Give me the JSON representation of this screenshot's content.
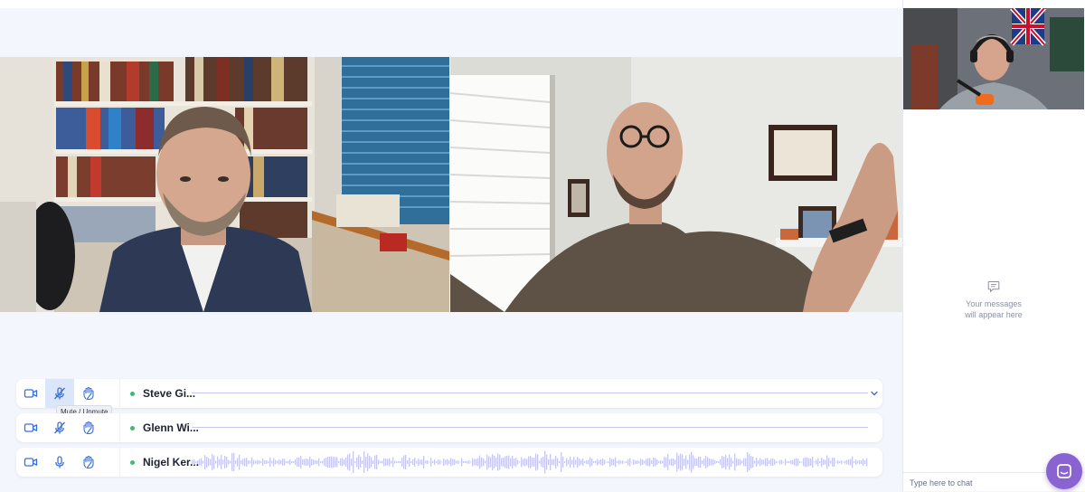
{
  "participants": [
    {
      "name": "Steve Gi...",
      "mic": "muted",
      "speaking": false
    },
    {
      "name": "Glenn Wi...",
      "mic": "muted",
      "speaking": false
    },
    {
      "name": "Nigel Ker...",
      "mic": "on",
      "speaking": true
    }
  ],
  "tooltip": "Mute / Unmute",
  "chat": {
    "empty_line1": "Your messages",
    "empty_line2": "will appear here",
    "placeholder": "Type here to chat"
  },
  "icons": {
    "camera": "video-camera-icon",
    "mic": "microphone-icon",
    "mic_muted": "microphone-muted-icon",
    "raise_hand": "raise-hand-icon",
    "expand": "chevron-down-icon",
    "chat": "chat-bubble-icon"
  },
  "colors": {
    "icon_blue": "#3b6fd8",
    "speaking_dot": "#3dbb73",
    "waveform": "#c8c7ef",
    "fab": "#8a63d2",
    "active_control": "#dbe6fb"
  }
}
